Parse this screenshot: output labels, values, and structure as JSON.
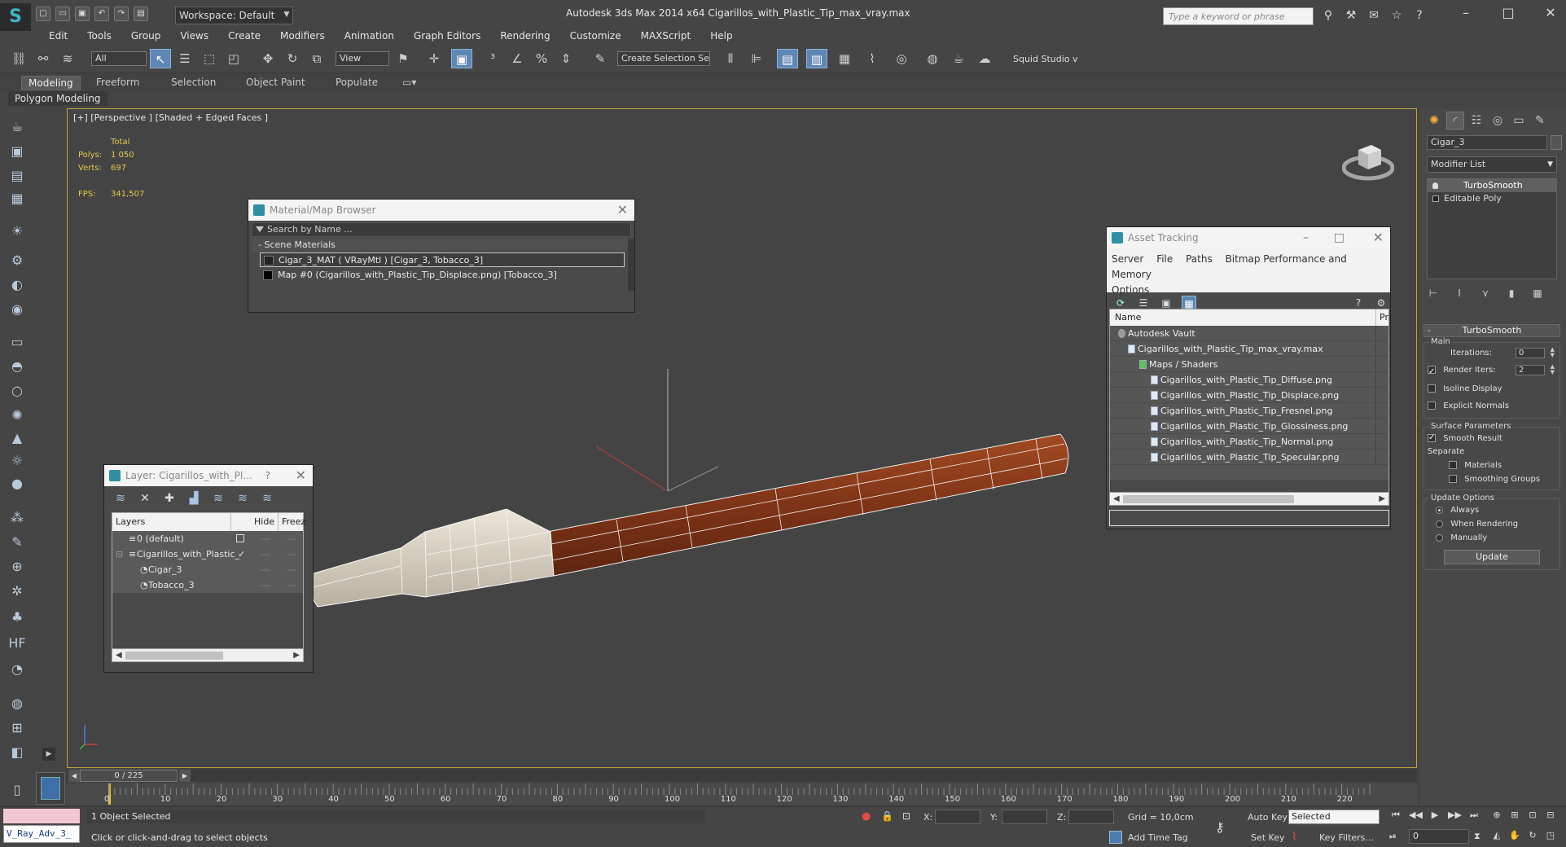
{
  "app": {
    "title": "Autodesk 3ds Max  2014 x64     Cigarillos_with_Plastic_Tip_max_vray.max",
    "workspace": "Workspace: Default",
    "search_placeholder": "Type a keyword or phrase"
  },
  "menu": [
    "Edit",
    "Tools",
    "Group",
    "Views",
    "Create",
    "Modifiers",
    "Animation",
    "Graph Editors",
    "Rendering",
    "Customize",
    "MAXScript",
    "Help"
  ],
  "toolbar": {
    "selection_filter": "All",
    "ref_coord": "View",
    "named_selection": "Create Selection Se",
    "plugin_label": "Squid Studio v"
  },
  "ribbon": {
    "tabs": [
      "Modeling",
      "Freeform",
      "Selection",
      "Object Paint",
      "Populate"
    ],
    "active_panel": "Polygon Modeling"
  },
  "viewport": {
    "label": "[+] [Perspective ] [Shaded + Edged Faces ]",
    "stats": {
      "total_label": "Total",
      "polys_label": "Polys:",
      "polys": "1 050",
      "verts_label": "Verts:",
      "verts": "697",
      "fps_label": "FPS:",
      "fps": "341,507"
    }
  },
  "material_browser": {
    "title": "Material/Map Browser",
    "search_placeholder": "Search by Name ...",
    "section": "- Scene Materials",
    "items": [
      "Cigar_3_MAT  ( VRayMtl ) [Cigar_3, Tobacco_3]",
      "Map #0 (Cigarillos_with_Plastic_Tip_Displace.png) [Tobacco_3]"
    ]
  },
  "layer_explorer": {
    "title": "Layer: Cigarillos_with_Pl...",
    "help": "?",
    "columns": {
      "layers": "Layers",
      "hide": "Hide",
      "freeze": "Freez"
    },
    "rows": [
      {
        "name": "0 (default)",
        "indent": 1
      },
      {
        "name": "Cigarillos_with_Plastic_",
        "indent": 1
      },
      {
        "name": "Cigar_3",
        "indent": 2
      },
      {
        "name": "Tobacco_3",
        "indent": 2
      }
    ]
  },
  "asset_tracking": {
    "title": "Asset Tracking",
    "menu": [
      "Server",
      "File",
      "Paths",
      "Bitmap Performance and Memory",
      "Options"
    ],
    "columns": {
      "name": "Name",
      "pr": "Pr"
    },
    "rows": [
      {
        "name": "Autodesk Vault",
        "level": 0
      },
      {
        "name": "Cigarillos_with_Plastic_Tip_max_vray.max",
        "level": 1
      },
      {
        "name": "Maps / Shaders",
        "level": 2
      },
      {
        "name": "Cigarillos_with_Plastic_Tip_Diffuse.png",
        "level": 3
      },
      {
        "name": "Cigarillos_with_Plastic_Tip_Displace.png",
        "level": 3
      },
      {
        "name": "Cigarillos_with_Plastic_Tip_Fresnel.png",
        "level": 3
      },
      {
        "name": "Cigarillos_with_Plastic_Tip_Glossiness.png",
        "level": 3
      },
      {
        "name": "Cigarillos_with_Plastic_Tip_Normal.png",
        "level": 3
      },
      {
        "name": "Cigarillos_with_Plastic_Tip_Specular.png",
        "level": 3
      }
    ]
  },
  "command_panel": {
    "object_name": "Cigar_3",
    "modifier_list": "Modifier List",
    "stack": [
      "TurboSmooth",
      "Editable Poly"
    ],
    "rollout": {
      "title": "TurboSmooth",
      "main": "Main",
      "iterations_label": "Iterations:",
      "iterations": "0",
      "render_iters_label": "Render Iters:",
      "render_iters": "2",
      "isoline": "Isoline Display",
      "explicit_normals": "Explicit Normals",
      "surface_params": "Surface Parameters",
      "smooth_result": "Smooth Result",
      "separate": "Separate",
      "materials": "Materials",
      "smoothing_groups": "Smoothing Groups",
      "update_options": "Update Options",
      "always": "Always",
      "when_rendering": "When Rendering",
      "manually": "Manually",
      "update_button": "Update"
    }
  },
  "timeline": {
    "frame_display": "0 / 225",
    "ticks": [
      "0",
      "10",
      "20",
      "30",
      "40",
      "50",
      "60",
      "70",
      "80",
      "90",
      "100",
      "110",
      "120",
      "130",
      "140",
      "150",
      "160",
      "170",
      "180",
      "190",
      "200",
      "210",
      "220"
    ]
  },
  "status": {
    "maxscript": "V_Ray_Adv_3_",
    "selection": "1 Object Selected",
    "prompt": "Click or click-and-drag to select objects",
    "x_label": "X:",
    "y_label": "Y:",
    "z_label": "Z:",
    "grid": "Grid = 10,0cm",
    "add_time_tag": "Add Time Tag",
    "auto_key": "Auto Key",
    "auto_key_value": "Selected",
    "set_key": "Set Key",
    "key_filters": "Key Filters...",
    "current_frame": "0"
  },
  "colors": {
    "viewport_border": "#c0a23a",
    "stats_yellow": "#e5c84c",
    "active_blue": "#5e87b5",
    "cigar_brown": "#8a3e1c",
    "tip_cream": "#d9d2c2"
  }
}
